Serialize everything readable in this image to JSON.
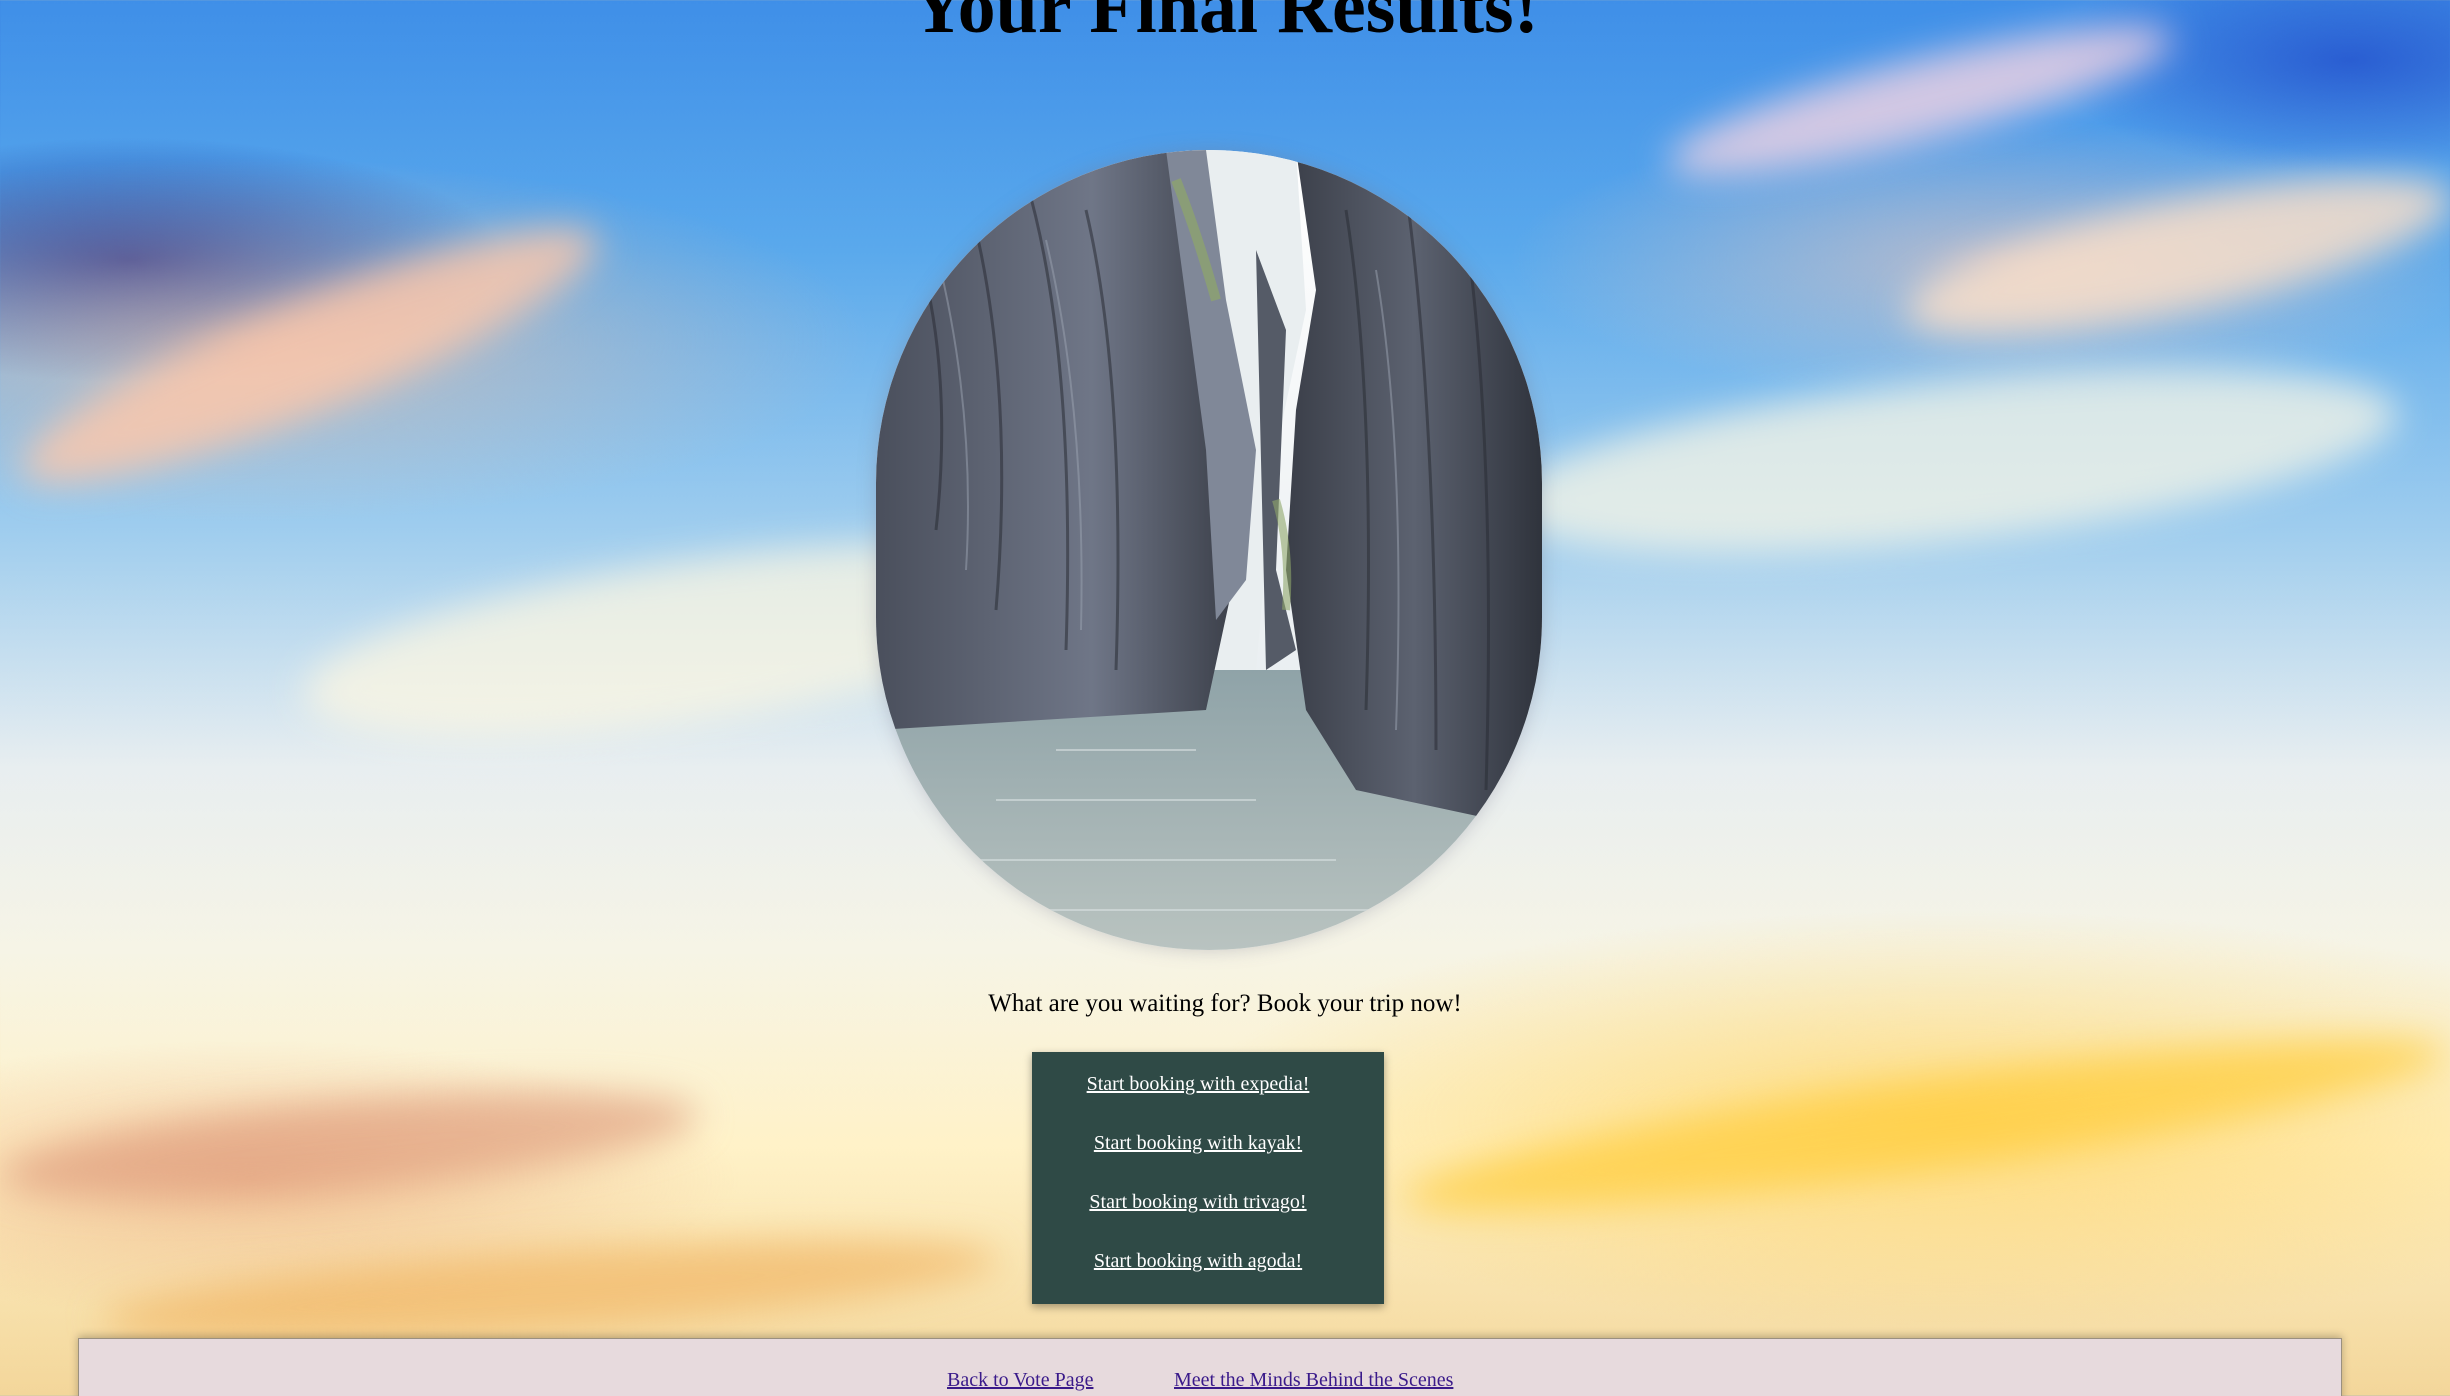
{
  "page": {
    "title": "Your Final Results!",
    "call_to_action": "What are you waiting for? Book your trip now!"
  },
  "result_image": {
    "icon": "canyon-river-photo"
  },
  "booking_links": [
    {
      "label": "Start booking with expedia!"
    },
    {
      "label": "Start booking with kayak!"
    },
    {
      "label": "Start booking with trivago!"
    },
    {
      "label": "Start booking with agoda!"
    }
  ],
  "footer": {
    "links": [
      {
        "label": "Back to Vote Page"
      },
      {
        "label": "Meet the Minds Behind the Scenes"
      }
    ]
  },
  "colors": {
    "booking_box_bg": "#2f4a46",
    "footer_bg": "#e7dadd",
    "link_color": "#3a1a8a"
  }
}
